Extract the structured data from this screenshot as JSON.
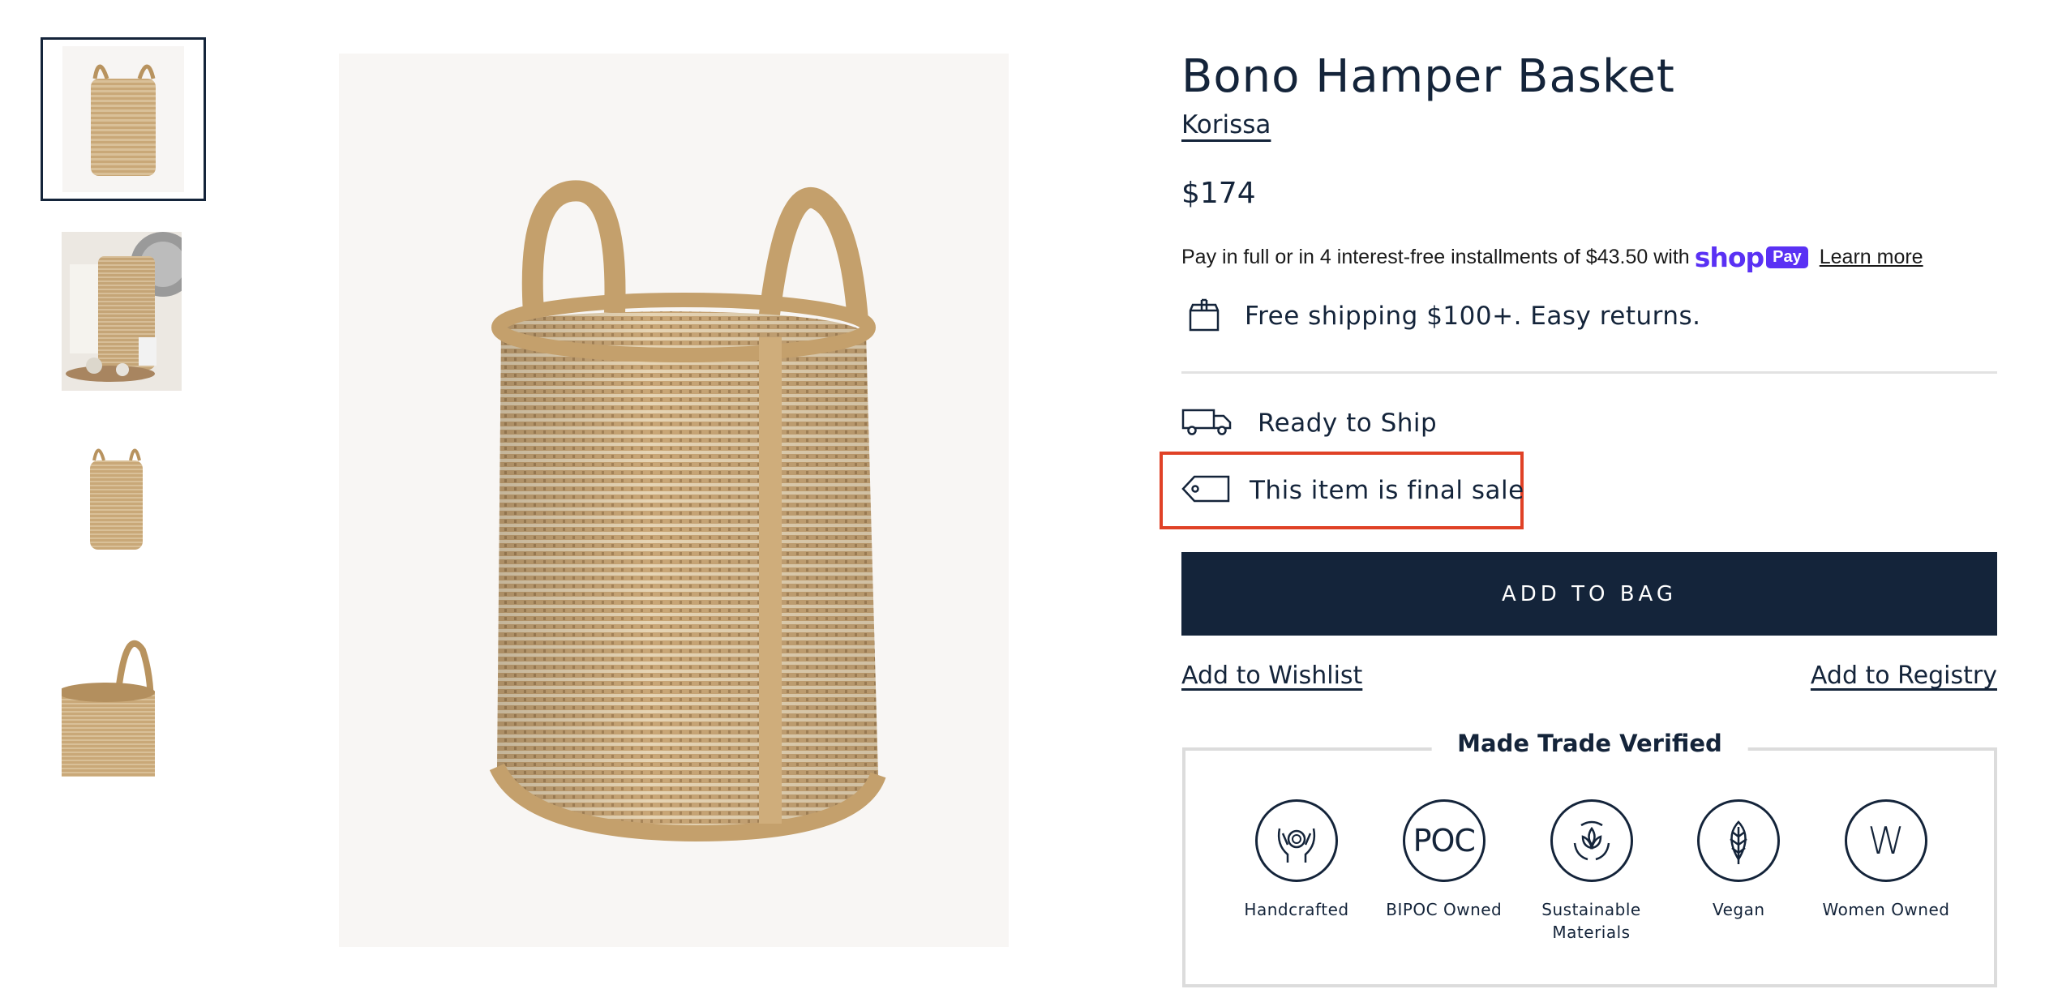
{
  "product": {
    "title": "Bono Hamper Basket",
    "brand": "Korissa",
    "price": "$174"
  },
  "installments": {
    "text": "Pay in full or in 4 interest-free installments of $43.50 with",
    "shop_word": "shop",
    "pay_badge": "Pay",
    "learn_more": "Learn more",
    "brand_color": "#5a31f4"
  },
  "shipping": {
    "icon": "box-icon",
    "label": "Free shipping $100+. Easy returns."
  },
  "availability": {
    "icon": "truck-icon",
    "label": "Ready to Ship"
  },
  "final_sale": {
    "icon": "tag-icon",
    "label": "This item is final sale",
    "highlight_color": "#e04126"
  },
  "actions": {
    "add_to_bag": "ADD TO BAG",
    "add_to_wishlist": "Add to Wishlist",
    "add_to_registry": "Add to Registry"
  },
  "verified": {
    "title": "Made Trade Verified",
    "badges": [
      {
        "label": "Handcrafted",
        "icon": "hands-icon"
      },
      {
        "label": "BIPOC Owned",
        "icon": "poc-icon",
        "glyph": "POC"
      },
      {
        "label": "Sustainable Materials",
        "icon": "recycle-leaf-icon"
      },
      {
        "label": "Vegan",
        "icon": "leaf-icon"
      },
      {
        "label": "Women Owned",
        "icon": "w-icon",
        "glyph": "W"
      }
    ]
  },
  "gallery": {
    "thumbnails": [
      "basket-front",
      "basket-in-room",
      "basket-small",
      "basket-handle-detail"
    ],
    "active_index": 0
  },
  "colors": {
    "navy": "#14243a",
    "background": "#ffffff"
  }
}
